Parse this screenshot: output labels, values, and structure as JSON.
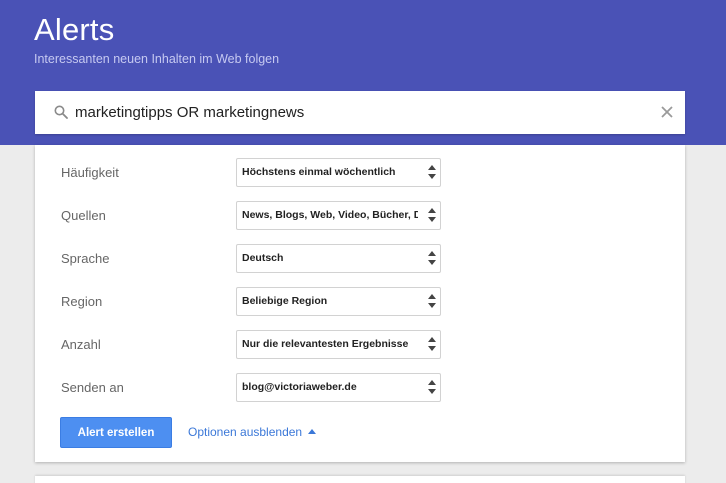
{
  "header": {
    "title": "Alerts",
    "subtitle": "Interessanten neuen Inhalten im Web folgen"
  },
  "search": {
    "query": "marketingtipps OR marketingnews"
  },
  "options": {
    "rows": [
      {
        "label": "Häufigkeit",
        "value": "Höchstens einmal wöchentlich"
      },
      {
        "label": "Quellen",
        "value": "News, Blogs, Web, Video, Bücher, Dis"
      },
      {
        "label": "Sprache",
        "value": "Deutsch"
      },
      {
        "label": "Region",
        "value": "Beliebige Region"
      },
      {
        "label": "Anzahl",
        "value": "Nur die relevantesten Ergebnisse"
      },
      {
        "label": "Senden an",
        "value": "blog@victoriaweber.de"
      }
    ]
  },
  "actions": {
    "create_label": "Alert erstellen",
    "toggle_options_label": "Optionen ausblenden"
  },
  "colors": {
    "header_bg": "#4a52b6",
    "button_bg": "#4d8ff1",
    "link": "#3b78d8"
  }
}
